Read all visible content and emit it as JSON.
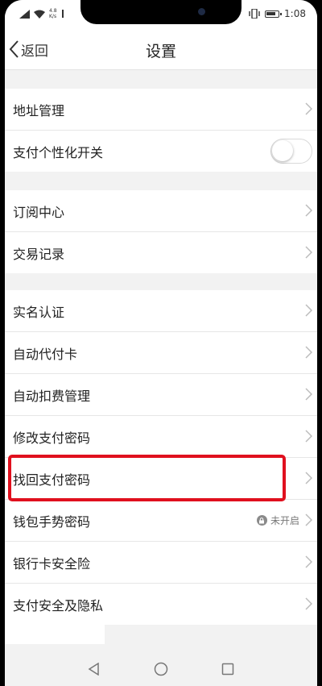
{
  "status_bar": {
    "network_speed": "4.8\nK/s",
    "time": "1:08"
  },
  "nav": {
    "back_label": "返回",
    "title": "设置"
  },
  "groups": [
    [
      {
        "label": "地址管理",
        "type": "chevron"
      },
      {
        "label": "支付个性化开关",
        "type": "toggle",
        "on": false
      }
    ],
    [
      {
        "label": "订阅中心",
        "type": "chevron"
      },
      {
        "label": "交易记录",
        "type": "chevron"
      }
    ],
    [
      {
        "label": "实名认证",
        "type": "chevron"
      },
      {
        "label": "自动代付卡",
        "type": "chevron"
      },
      {
        "label": "自动扣费管理",
        "type": "chevron"
      },
      {
        "label": "修改支付密码",
        "type": "chevron"
      },
      {
        "label": "找回支付密码",
        "type": "chevron",
        "highlighted": true
      },
      {
        "label": "钱包手势密码",
        "type": "chevron",
        "status": "未开启"
      },
      {
        "label": "银行卡安全险",
        "type": "chevron"
      },
      {
        "label": "支付安全及隐私",
        "type": "chevron"
      }
    ]
  ],
  "colors": {
    "highlight_border": "#e0101e",
    "background": "#f2f2f2"
  }
}
